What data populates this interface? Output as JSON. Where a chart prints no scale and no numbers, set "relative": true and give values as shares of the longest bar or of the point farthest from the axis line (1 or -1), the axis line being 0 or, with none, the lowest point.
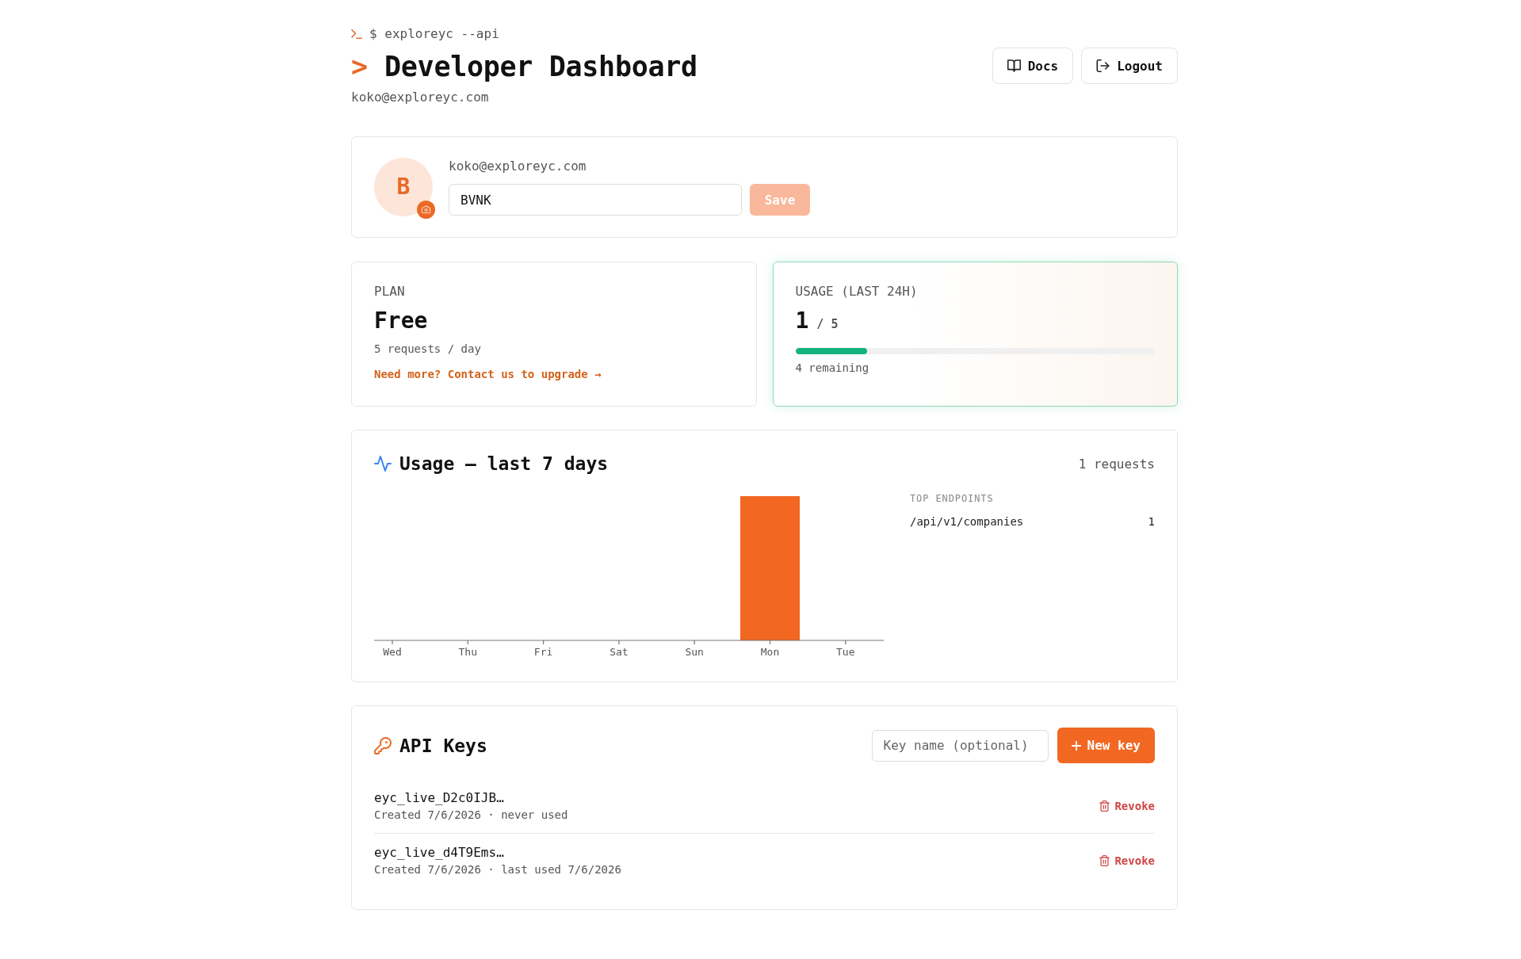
{
  "header": {
    "prompt": "$ exploreyc --api",
    "title_marker": ">",
    "title": "Developer Dashboard",
    "email": "koko@exploreyc.com",
    "buttons": [
      {
        "kind": "docs",
        "label": "Docs"
      },
      {
        "kind": "logout",
        "label": "Logout"
      }
    ]
  },
  "profile": {
    "avatar_initial": "B",
    "email": "koko@exploreyc.com",
    "name_field": {
      "value": "BVNK"
    },
    "save_button": {
      "label": "Save",
      "disabled": true
    }
  },
  "plan": {
    "label": "PLAN",
    "name": "Free",
    "limit": "5 requests / day",
    "upgrade_link": "Need more? Contact us to upgrade →"
  },
  "usage": {
    "label": "USAGE (LAST 24H)",
    "used": "1",
    "quota": "/ 5",
    "level": 0.2,
    "remaining": "4 remaining"
  },
  "weekly_usage": {
    "title": "Usage — last 7 days",
    "total": "1 requests",
    "chart_data": {
      "type": "bar",
      "relative": true,
      "categories": [
        "Wed",
        "Thu",
        "Fri",
        "Sat",
        "Sun",
        "Mon",
        "Tue"
      ],
      "values": [
        0,
        0,
        0,
        0,
        0,
        1,
        0
      ]
    },
    "top_endpoints": {
      "title": "TOP ENDPOINTS",
      "rows": [
        {
          "path": "/api/v1/companies",
          "count": "1"
        }
      ]
    }
  },
  "api_keys": {
    "title": "API Keys",
    "name_field": {
      "placeholder": "Key name (optional)"
    },
    "new_button": "New key",
    "keys": [
      {
        "name": "eyc_live_D2c0IJB…",
        "meta": "Created 7/6/2026 · never used",
        "action": "Revoke"
      },
      {
        "name": "eyc_live_d4T9Ems…",
        "meta": "Created 7/6/2026 · last used 7/6/2026",
        "action": "Revoke"
      }
    ]
  }
}
